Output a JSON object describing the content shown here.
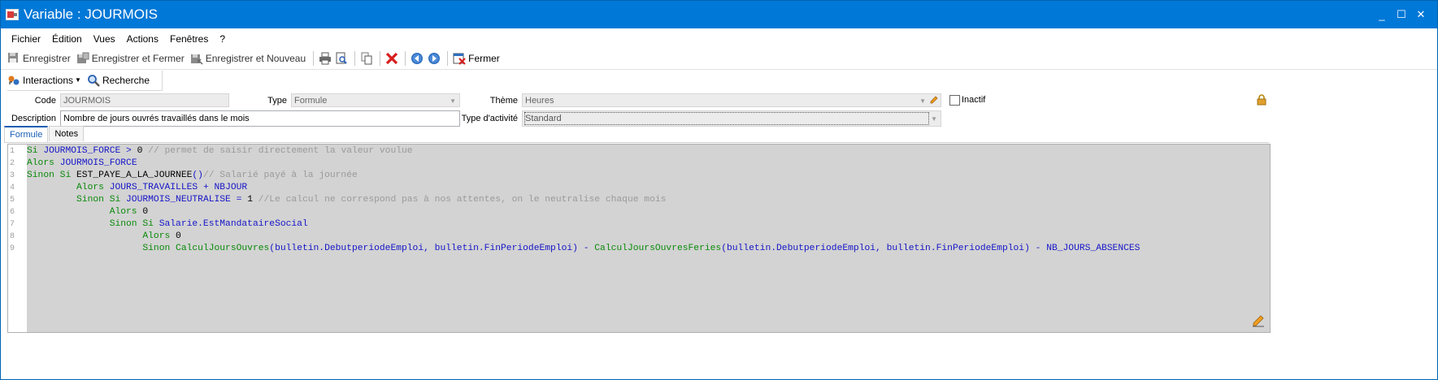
{
  "window": {
    "title": "Variable : JOURMOIS",
    "buttons": [
      "_",
      "☐",
      "✕"
    ]
  },
  "menu": [
    "Fichier",
    "Édition",
    "Vues",
    "Actions",
    "Fenêtres",
    "?"
  ],
  "toolbar": {
    "save": "Enregistrer",
    "save_close": "Enregistrer et Fermer",
    "save_new": "Enregistrer et Nouveau",
    "close": "Fermer"
  },
  "toolbar2": {
    "interactions": "Interactions",
    "search": "Recherche"
  },
  "form": {
    "code_label": "Code",
    "code_value": "JOURMOIS",
    "type_label": "Type",
    "type_value": "Formule",
    "theme_label": "Thème",
    "theme_value": "Heures",
    "inactive_label": "Inactif",
    "description_label": "Description",
    "description_value": "Nombre de jours ouvrés travaillés dans le mois",
    "activity_label": "Type d'activité",
    "activity_value": "Standard"
  },
  "tabs": [
    "Formule",
    "Notes"
  ],
  "code_lines": [
    {
      "n": "1",
      "parts": [
        {
          "c": "kw",
          "t": "Si "
        },
        {
          "c": "id",
          "t": "JOURMOIS_FORCE"
        },
        {
          "c": "op",
          "t": " > "
        },
        {
          "c": "nm",
          "t": "0"
        },
        {
          "c": "cm",
          "t": " // permet de saisir directement la valeur voulue"
        }
      ]
    },
    {
      "n": "2",
      "parts": [
        {
          "c": "kw",
          "t": "Alors "
        },
        {
          "c": "id",
          "t": "JOURMOIS_FORCE"
        }
      ]
    },
    {
      "n": "3",
      "parts": [
        {
          "c": "kw",
          "t": "Sinon Si "
        },
        {
          "c": "fn",
          "t": "EST_PAYE_A_LA_JOURNEE"
        },
        {
          "c": "id",
          "t": "()"
        },
        {
          "c": "cm",
          "t": "// Salarié payé à la journée"
        }
      ]
    },
    {
      "n": "4",
      "parts": [
        {
          "c": "kw",
          "t": "         Alors "
        },
        {
          "c": "id",
          "t": "JOURS_TRAVAILLES + NBJOUR"
        }
      ]
    },
    {
      "n": "5",
      "parts": [
        {
          "c": "kw",
          "t": "         Sinon Si "
        },
        {
          "c": "id",
          "t": "JOURMOIS_NEUTRALISE = "
        },
        {
          "c": "nm",
          "t": "1"
        },
        {
          "c": "cm",
          "t": " //Le calcul ne correspond pas à nos attentes, on le neutralise chaque mois"
        }
      ]
    },
    {
      "n": "6",
      "parts": [
        {
          "c": "kw",
          "t": "               Alors "
        },
        {
          "c": "nm",
          "t": "0"
        }
      ]
    },
    {
      "n": "7",
      "parts": [
        {
          "c": "kw",
          "t": "               Sinon Si "
        },
        {
          "c": "id",
          "t": "Salarie.EstMandataireSocial"
        }
      ]
    },
    {
      "n": "8",
      "parts": [
        {
          "c": "kw",
          "t": "                     Alors "
        },
        {
          "c": "nm",
          "t": "0"
        }
      ]
    },
    {
      "n": "9",
      "parts": [
        {
          "c": "kw",
          "t": "                     Sinon "
        },
        {
          "c": "kw",
          "t": "CalculJoursOuvres"
        },
        {
          "c": "id",
          "t": "(bulletin.DebutperiodeEmploi, bulletin.FinPeriodeEmploi) - "
        },
        {
          "c": "kw",
          "t": "CalculJoursOuvresFeries"
        },
        {
          "c": "id",
          "t": "(bulletin.DebutperiodeEmploi, bulletin.FinPeriodeEmploi) - NB_JOURS_ABSENCES"
        }
      ]
    }
  ],
  "colors": {
    "titlebar": "#0078d7",
    "keyword": "#0a8a0a",
    "identifier": "#1515c8",
    "comment": "#9a9a9a"
  }
}
